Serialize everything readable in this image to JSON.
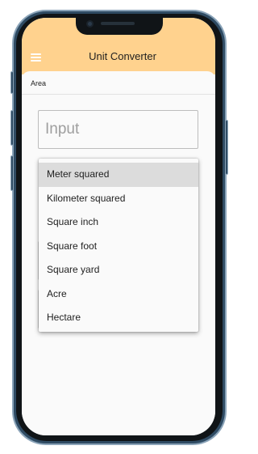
{
  "app_bar": {
    "title": "Unit Converter",
    "menu_icon": "hamburger-menu-icon",
    "background": "#ffd28e"
  },
  "category": {
    "label": "Area"
  },
  "input": {
    "placeholder": "Input"
  },
  "unit_dropdown": {
    "selected": "Meter squared",
    "options": [
      "Meter squared",
      "Kilometer squared",
      "Square inch",
      "Square foot",
      "Square yard",
      "Acre",
      "Hectare"
    ]
  }
}
